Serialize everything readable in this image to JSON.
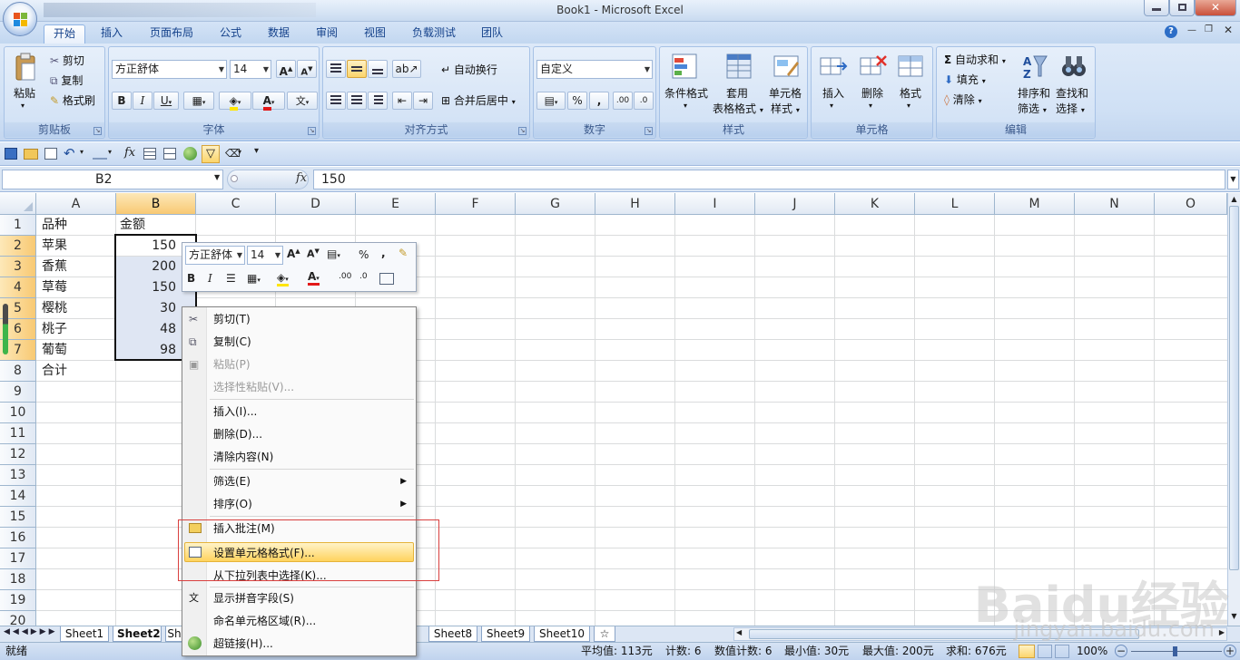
{
  "window": {
    "title": "Book1 - Microsoft Excel"
  },
  "tabs": [
    {
      "label": "开始",
      "active": true
    },
    {
      "label": "插入"
    },
    {
      "label": "页面布局"
    },
    {
      "label": "公式"
    },
    {
      "label": "数据"
    },
    {
      "label": "审阅"
    },
    {
      "label": "视图"
    },
    {
      "label": "负载测试"
    },
    {
      "label": "团队"
    }
  ],
  "ribbon": {
    "clipboard": {
      "label": "剪贴板",
      "paste": "粘贴",
      "cut": "剪切",
      "copy": "复制",
      "format_painter": "格式刷"
    },
    "font": {
      "label": "字体",
      "name": "方正舒体",
      "size": "14"
    },
    "alignment": {
      "label": "对齐方式",
      "wrap": "自动换行",
      "merge": "合并后居中"
    },
    "number": {
      "label": "数字",
      "format": "自定义"
    },
    "styles": {
      "label": "样式",
      "conditional": "条件格式",
      "table_1": "套用",
      "table_2": "表格格式",
      "cell_1": "单元格",
      "cell_2": "样式"
    },
    "cells": {
      "label": "单元格",
      "insert": "插入",
      "delete": "删除",
      "format": "格式"
    },
    "editing": {
      "label": "编辑",
      "autosum": "自动求和",
      "fill": "填充",
      "clear": "清除",
      "sort_1": "排序和",
      "sort_2": "筛选",
      "find_1": "查找和",
      "find_2": "选择"
    }
  },
  "formula_bar": {
    "name_box": "B2",
    "fx": "fx",
    "value": "150"
  },
  "columns": [
    "A",
    "B",
    "C",
    "D",
    "E",
    "F",
    "G",
    "H",
    "I",
    "J",
    "K",
    "L",
    "M",
    "N",
    "O"
  ],
  "rows": [
    "1",
    "2",
    "3",
    "4",
    "5",
    "6",
    "7",
    "8",
    "9",
    "10",
    "11",
    "12",
    "13",
    "14",
    "15",
    "16",
    "17",
    "18",
    "19",
    "20"
  ],
  "cells": {
    "a1": "品种",
    "b1": "金额",
    "a2": "苹果",
    "b2": "150",
    "a3": "香蕉",
    "b3": "200",
    "a4": "草莓",
    "b4": "150",
    "a5": "樱桃",
    "b5": "30",
    "a6": "桃子",
    "b6": "48",
    "a7": "葡萄",
    "b7": "98",
    "a8": "合计"
  },
  "mini_toolbar": {
    "font": "方正舒体",
    "size": "14",
    "percent": "%",
    "comma": ","
  },
  "context_menu": [
    {
      "label": "剪切(T)",
      "icon": "scissors-icon"
    },
    {
      "label": "复制(C)",
      "icon": "copy-icon"
    },
    {
      "label": "粘贴(P)",
      "icon": "paste-icon",
      "disabled": true
    },
    {
      "label": "选择性粘贴(V)...",
      "disabled": true
    },
    {
      "label": "插入(I)..."
    },
    {
      "label": "删除(D)..."
    },
    {
      "label": "清除内容(N)"
    },
    {
      "label": "筛选(E)",
      "submenu": true
    },
    {
      "label": "排序(O)",
      "submenu": true
    },
    {
      "label": "插入批注(M)",
      "icon": "comment-icon"
    },
    {
      "label": "设置单元格格式(F)...",
      "icon": "format-cells-icon",
      "highlighted": true
    },
    {
      "label": "从下拉列表中选择(K)..."
    },
    {
      "label": "显示拼音字段(S)",
      "icon": "phonetic-icon"
    },
    {
      "label": "命名单元格区域(R)..."
    },
    {
      "label": "超链接(H)...",
      "icon": "hyperlink-icon"
    }
  ],
  "sheets": [
    "Sheet1",
    "Sheet2",
    "Sh",
    "Sheet8",
    "Sheet9",
    "Sheet10"
  ],
  "status": {
    "ready": "就绪",
    "average": "平均值: 113元",
    "count": "计数: 6",
    "num_count": "数值计数: 6",
    "min": "最小值: 30元",
    "max": "最大值: 200元",
    "sum": "求和: 676元",
    "zoom": "100%"
  },
  "watermark": {
    "brand": "Baidu经验",
    "url": "jingyan.baidu.com"
  },
  "colors": {
    "accent": "#15428b",
    "selection": "#f8c973",
    "highlight": "#ffd35e",
    "callout": "#d9403f"
  }
}
